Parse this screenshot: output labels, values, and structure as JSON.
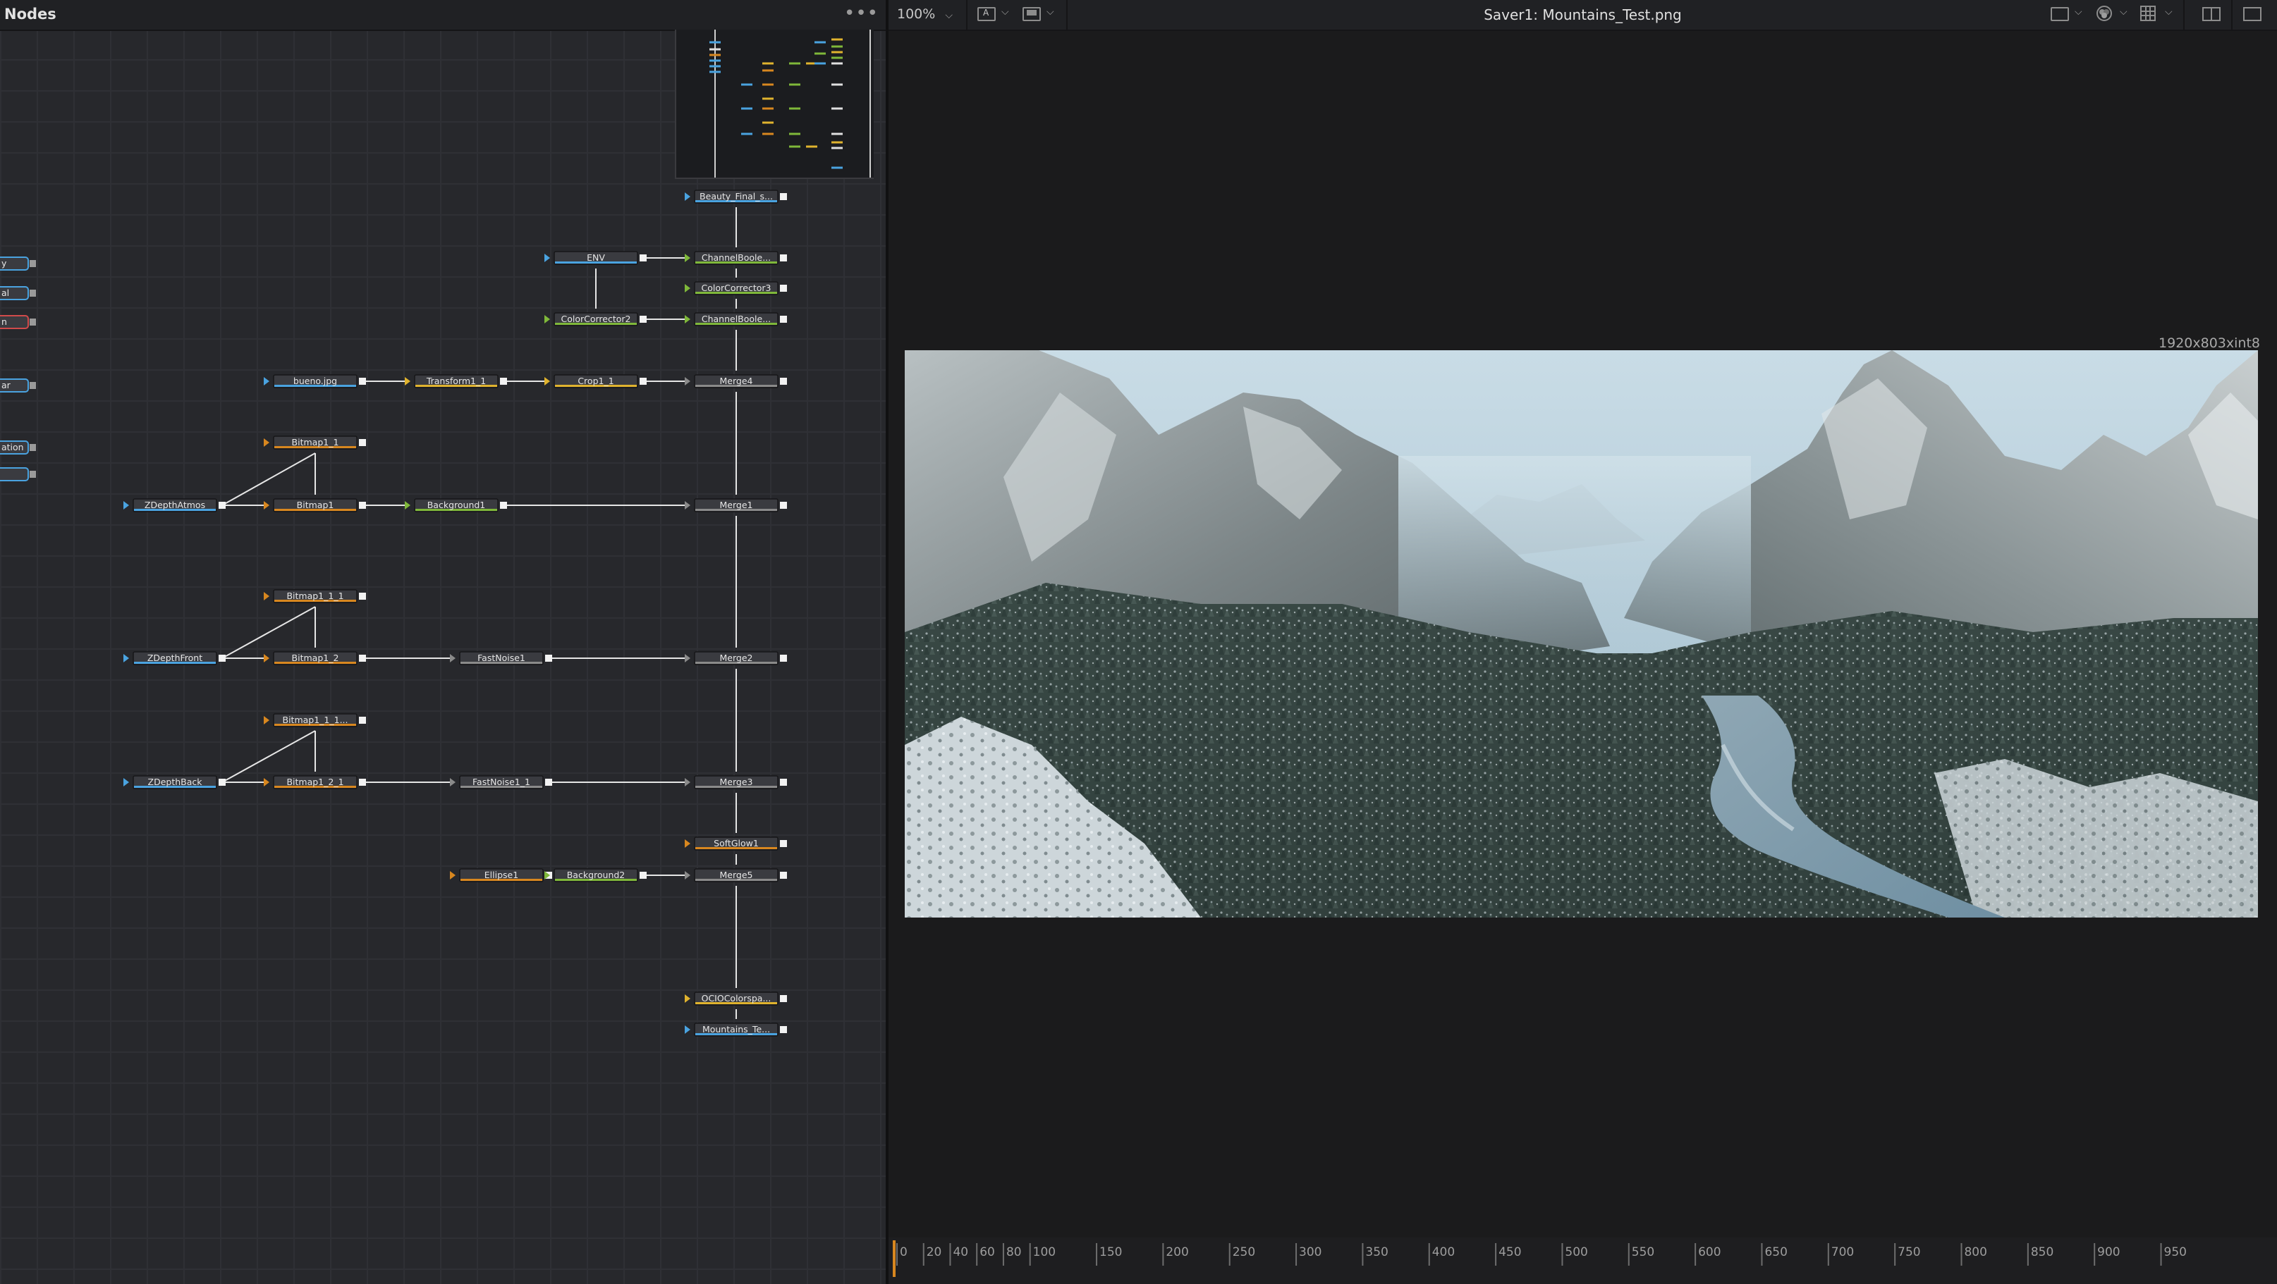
{
  "nodes_panel": {
    "title": "Nodes",
    "menu_icon": "ellipsis-icon",
    "partial_left_nodes": [
      "y",
      "al",
      "n",
      "ar",
      "ation",
      ""
    ],
    "nodes": [
      {
        "id": "beauty",
        "label": "Beauty_Final_s..."
      },
      {
        "id": "channelbool1",
        "label": "ChannelBoole..."
      },
      {
        "id": "env",
        "label": "ENV"
      },
      {
        "id": "colorcorrector3",
        "label": "ColorCorrector3"
      },
      {
        "id": "colorcorrector2",
        "label": "ColorCorrector2"
      },
      {
        "id": "channelbool2",
        "label": "ChannelBoole..."
      },
      {
        "id": "bueno",
        "label": "bueno.jpg"
      },
      {
        "id": "transform1_1",
        "label": "Transform1_1"
      },
      {
        "id": "crop1_1",
        "label": "Crop1_1"
      },
      {
        "id": "merge4",
        "label": "Merge4"
      },
      {
        "id": "bitmap1_1",
        "label": "Bitmap1_1"
      },
      {
        "id": "zdepthatmos",
        "label": "ZDepthAtmos"
      },
      {
        "id": "bitmap1",
        "label": "Bitmap1"
      },
      {
        "id": "background1",
        "label": "Background1"
      },
      {
        "id": "merge1",
        "label": "Merge1"
      },
      {
        "id": "bitmap1_1_1",
        "label": "Bitmap1_1_1"
      },
      {
        "id": "zdepthfront",
        "label": "ZDepthFront"
      },
      {
        "id": "bitmap1_2",
        "label": "Bitmap1_2"
      },
      {
        "id": "fastnoise1",
        "label": "FastNoise1"
      },
      {
        "id": "merge2",
        "label": "Merge2"
      },
      {
        "id": "bitmap1_1_1_1",
        "label": "Bitmap1_1_1..."
      },
      {
        "id": "zdepthback",
        "label": "ZDepthBack"
      },
      {
        "id": "bitmap1_2_1",
        "label": "Bitmap1_2_1"
      },
      {
        "id": "fastnoise1_1",
        "label": "FastNoise1_1"
      },
      {
        "id": "merge3",
        "label": "Merge3"
      },
      {
        "id": "softglow1",
        "label": "SoftGlow1"
      },
      {
        "id": "ellipse1",
        "label": "Ellipse1"
      },
      {
        "id": "background2",
        "label": "Background2"
      },
      {
        "id": "merge5",
        "label": "Merge5"
      },
      {
        "id": "ociocolorspace",
        "label": "OCIOColorspa..."
      },
      {
        "id": "saver",
        "label": "Mountains_Te..."
      }
    ]
  },
  "viewer": {
    "zoom": "100%",
    "title": "Saver1: Mountains_Test.png",
    "resolution": "1920x803xint8",
    "icons": [
      "channel-a-icon",
      "display-icon",
      "roi-icon",
      "color-wheel-icon",
      "grid-icon",
      "split-view-icon"
    ],
    "image": "snowy-mountain-valley-render"
  },
  "timeline_ruler": {
    "ticks": [
      0,
      20,
      40,
      60,
      80,
      100,
      150,
      200,
      250,
      300,
      350,
      400,
      450,
      500,
      550,
      600,
      650,
      700,
      750,
      800,
      850,
      900,
      950
    ],
    "playhead_frame": 0
  },
  "colors": {
    "link": "#e6e6e6",
    "node_blue": "#4aa3e0",
    "node_yellow": "#e0b32e",
    "node_green": "#7fb83a",
    "node_orange": "#d8871f",
    "node_gray": "#8a8a8a"
  }
}
